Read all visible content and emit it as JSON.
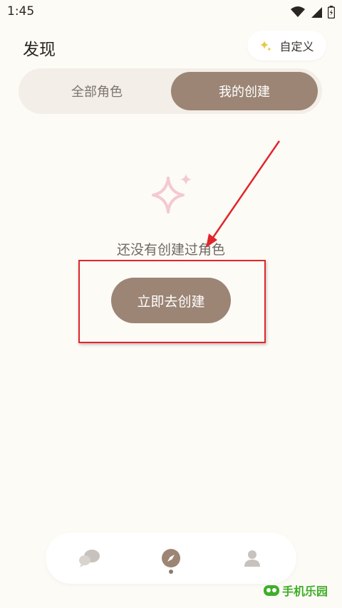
{
  "status_bar": {
    "time": "1:45"
  },
  "header": {
    "title": "发现",
    "customize_label": "自定义"
  },
  "tabs": [
    {
      "label": "全部角色",
      "active": false
    },
    {
      "label": "我的创建",
      "active": true
    }
  ],
  "empty_state": {
    "message": "还没有创建过角色",
    "action_label": "立即去创建"
  },
  "bottom_nav": {
    "items": [
      {
        "icon": "chat-bubbles-icon",
        "active": false
      },
      {
        "icon": "compass-icon",
        "active": true
      },
      {
        "icon": "profile-icon",
        "active": false
      }
    ]
  },
  "watermark": {
    "text": "手机乐园"
  },
  "colors": {
    "background": "#fdfbf6",
    "accent": "#9c8575",
    "annotation_red": "#e0262a",
    "sparkle_pink": "#f4c9d2",
    "watermark_green": "#3fae29"
  }
}
